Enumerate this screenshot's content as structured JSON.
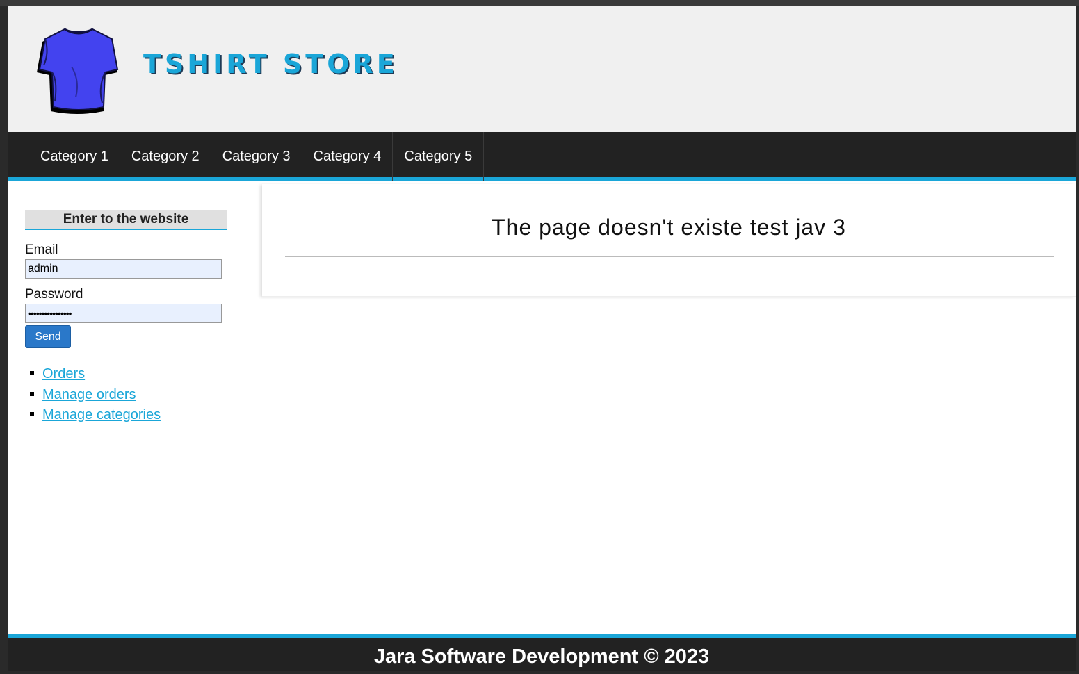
{
  "header": {
    "logo_icon": "tshirt-icon",
    "store_name": "TSHIRT STORE",
    "colors": {
      "title": "#1aa6d8",
      "tshirt": "#4040f0"
    }
  },
  "nav": {
    "items": [
      {
        "label": "Category 1"
      },
      {
        "label": "Category 2"
      },
      {
        "label": "Category 3"
      },
      {
        "label": "Category 4"
      },
      {
        "label": "Category 5"
      }
    ],
    "accent": "#1aa6d8"
  },
  "login": {
    "heading": "Enter to the website",
    "email_label": "Email",
    "email_value": "admin",
    "password_label": "Password",
    "password_value": "••••••••••••••••",
    "send_label": "Send"
  },
  "links": [
    {
      "label": "Orders"
    },
    {
      "label": "Manage orders"
    },
    {
      "label": "Manage categories"
    }
  ],
  "main": {
    "title": "The page doesn't existe test jav 3"
  },
  "footer": {
    "text": "Jara Software Development © 2023"
  }
}
